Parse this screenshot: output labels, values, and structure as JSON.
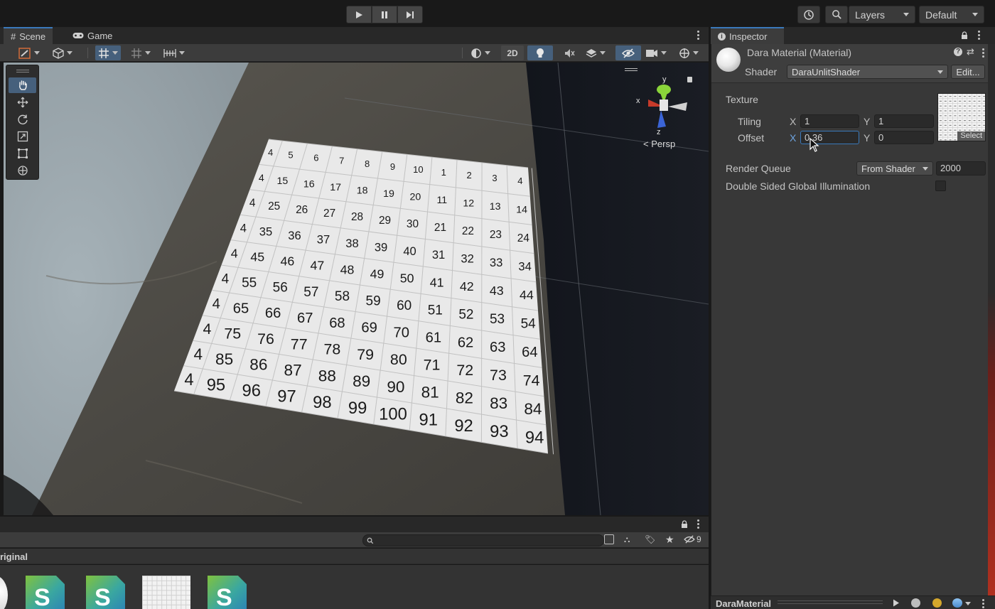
{
  "toolbar": {
    "layers_label": "Layers",
    "layout_label": "Default"
  },
  "scene_panel": {
    "tabs": [
      {
        "label": "Scene",
        "icon": "hash-icon"
      },
      {
        "label": "Game",
        "icon": "gamepad-icon"
      }
    ],
    "mode_2d_label": "2D",
    "view_label": "Persp",
    "gizmo_axes": {
      "x": "x",
      "y": "y",
      "z": "z"
    }
  },
  "grid_texture": {
    "rows": [
      [
        "5",
        "6",
        "7",
        "8",
        "9",
        "10",
        "1",
        "2",
        "3",
        "4"
      ],
      [
        "15",
        "16",
        "17",
        "18",
        "19",
        "20",
        "11",
        "12",
        "13",
        "14"
      ],
      [
        "25",
        "26",
        "27",
        "28",
        "29",
        "30",
        "21",
        "22",
        "23",
        "24"
      ],
      [
        "35",
        "36",
        "37",
        "38",
        "39",
        "40",
        "31",
        "32",
        "33",
        "34"
      ],
      [
        "45",
        "46",
        "47",
        "48",
        "49",
        "50",
        "41",
        "42",
        "43",
        "44"
      ],
      [
        "55",
        "56",
        "57",
        "58",
        "59",
        "60",
        "51",
        "52",
        "53",
        "54"
      ],
      [
        "65",
        "66",
        "67",
        "68",
        "69",
        "70",
        "61",
        "62",
        "63",
        "64"
      ],
      [
        "75",
        "76",
        "77",
        "78",
        "79",
        "80",
        "71",
        "72",
        "73",
        "74"
      ],
      [
        "85",
        "86",
        "87",
        "88",
        "89",
        "90",
        "81",
        "82",
        "83",
        "84"
      ],
      [
        "95",
        "96",
        "97",
        "98",
        "99",
        "100",
        "91",
        "92",
        "93",
        "94"
      ]
    ],
    "left_partial": "4"
  },
  "inspector": {
    "tab_label": "Inspector",
    "material_name": "Dara Material (Material)",
    "shader_label": "Shader",
    "shader_value": "DaraUnlitShader",
    "edit_label": "Edit...",
    "texture_label": "Texture",
    "tiling_label": "Tiling",
    "offset_label": "Offset",
    "x_label": "X",
    "y_label": "Y",
    "tiling_x": "1",
    "tiling_y": "1",
    "offset_x": "0.36",
    "offset_y": "0",
    "select_label": "Select",
    "render_queue_label": "Render Queue",
    "render_queue_mode": "From Shader",
    "render_queue_value": "2000",
    "double_sided_label": "Double Sided Global Illumination",
    "double_sided_checked": false,
    "footer_label": "DaraMaterial"
  },
  "project_panel": {
    "folder_label": "riginal",
    "hidden_count": "9",
    "search_placeholder": "",
    "shader_letter": "S"
  }
}
